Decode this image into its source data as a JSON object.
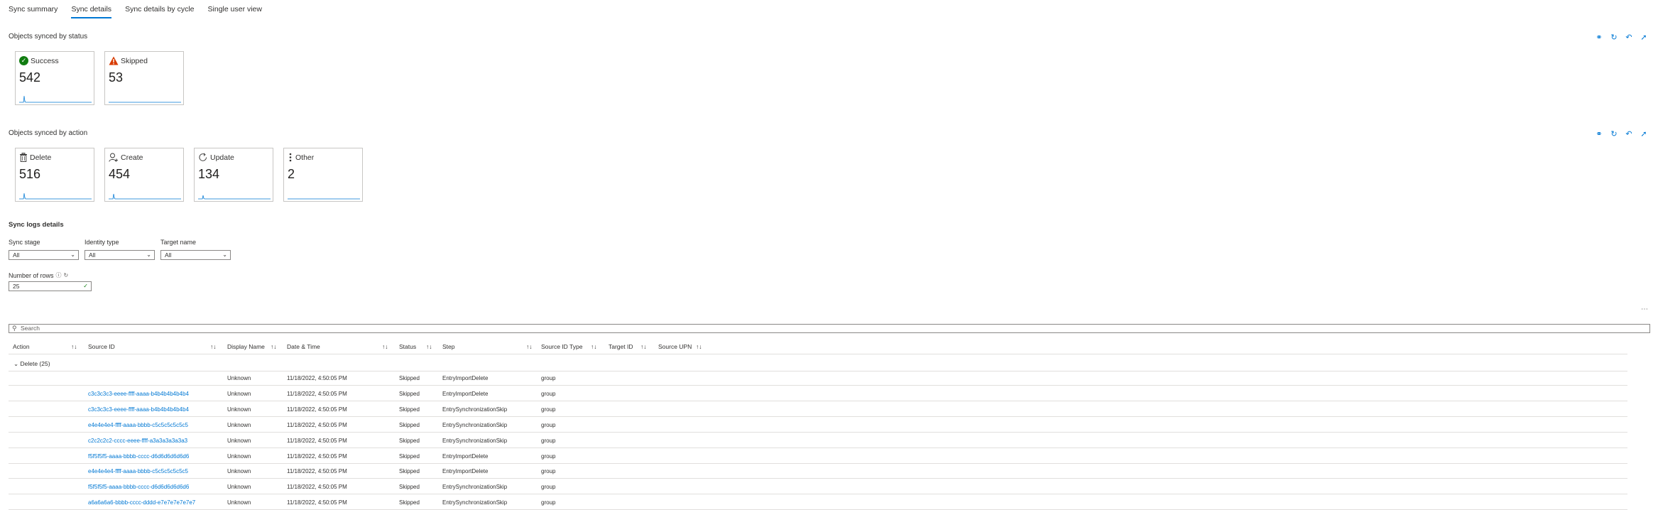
{
  "tabs": [
    "Sync summary",
    "Sync details",
    "Sync details by cycle",
    "Single user view"
  ],
  "active_tab_index": 1,
  "status_section": {
    "title": "Objects synced by status",
    "tiles": [
      {
        "label": "Success",
        "value": "542",
        "icon": "check-circle-icon",
        "color": "#107c10"
      },
      {
        "label": "Skipped",
        "value": "53",
        "icon": "warning-icon",
        "color": "#d83b01"
      }
    ]
  },
  "action_section": {
    "title": "Objects synced by action",
    "tiles": [
      {
        "label": "Delete",
        "value": "516",
        "icon": "trash-icon"
      },
      {
        "label": "Create",
        "value": "454",
        "icon": "add-user-icon"
      },
      {
        "label": "Update",
        "value": "134",
        "icon": "refresh-cycle-icon"
      },
      {
        "label": "Other",
        "value": "2",
        "icon": "more-vertical-icon"
      }
    ]
  },
  "logs": {
    "title": "Sync logs details",
    "filters": {
      "sync_stage": {
        "label": "Sync stage",
        "value": "All"
      },
      "identity_type": {
        "label": "Identity type",
        "value": "All"
      },
      "target_name": {
        "label": "Target name",
        "value": "All"
      },
      "rows": {
        "label": "Number of rows",
        "value": "25"
      }
    },
    "search_placeholder": "Search",
    "columns": [
      "Action",
      "Source ID",
      "Display Name",
      "Date & Time",
      "Status",
      "Step",
      "Source ID Type",
      "Target ID",
      "Source UPN"
    ],
    "group_label": "Delete (25)",
    "rows": [
      {
        "source_id": "",
        "display": "Unknown",
        "date": "11/18/2022, 4:50:05 PM",
        "status": "Skipped",
        "step": "EntryImportDelete",
        "type": "group"
      },
      {
        "source_id": "c3c3c3c3-eeee-ffff-aaaa-b4b4b4b4b4b4",
        "display": "Unknown",
        "date": "11/18/2022, 4:50:05 PM",
        "status": "Skipped",
        "step": "EntryImportDelete",
        "type": "group"
      },
      {
        "source_id": "c3c3c3c3-eeee-ffff-aaaa-b4b4b4b4b4b4",
        "display": "Unknown",
        "date": "11/18/2022, 4:50:05 PM",
        "status": "Skipped",
        "step": "EntrySynchronizationSkip",
        "type": "group"
      },
      {
        "source_id": "e4e4e4e4-ffff-aaaa-bbbb-c5c5c5c5c5c5",
        "display": "Unknown",
        "date": "11/18/2022, 4:50:05 PM",
        "status": "Skipped",
        "step": "EntrySynchronizationSkip",
        "type": "group"
      },
      {
        "source_id": "c2c2c2c2-cccc-eeee-ffff-a3a3a3a3a3a3",
        "display": "Unknown",
        "date": "11/18/2022, 4:50:05 PM",
        "status": "Skipped",
        "step": "EntrySynchronizationSkip",
        "type": "group"
      },
      {
        "source_id": "f5f5f5f5-aaaa-bbbb-cccc-d6d6d6d6d6d6",
        "display": "Unknown",
        "date": "11/18/2022, 4:50:05 PM",
        "status": "Skipped",
        "step": "EntryImportDelete",
        "type": "group"
      },
      {
        "source_id": "e4e4e4e4-ffff-aaaa-bbbb-c5c5c5c5c5c5",
        "display": "Unknown",
        "date": "11/18/2022, 4:50:05 PM",
        "status": "Skipped",
        "step": "EntryImportDelete",
        "type": "group"
      },
      {
        "source_id": "f5f5f5f5-aaaa-bbbb-cccc-d6d6d6d6d6d6",
        "display": "Unknown",
        "date": "11/18/2022, 4:50:05 PM",
        "status": "Skipped",
        "step": "EntrySynchronizationSkip",
        "type": "group"
      },
      {
        "source_id": "a6a6a6a6-bbbb-cccc-dddd-e7e7e7e7e7e7",
        "display": "Unknown",
        "date": "11/18/2022, 4:50:05 PM",
        "status": "Skipped",
        "step": "EntrySynchronizationSkip",
        "type": "group"
      }
    ]
  },
  "colors": {
    "accent": "#0078d4",
    "success": "#107c10",
    "warning": "#d83b01"
  }
}
